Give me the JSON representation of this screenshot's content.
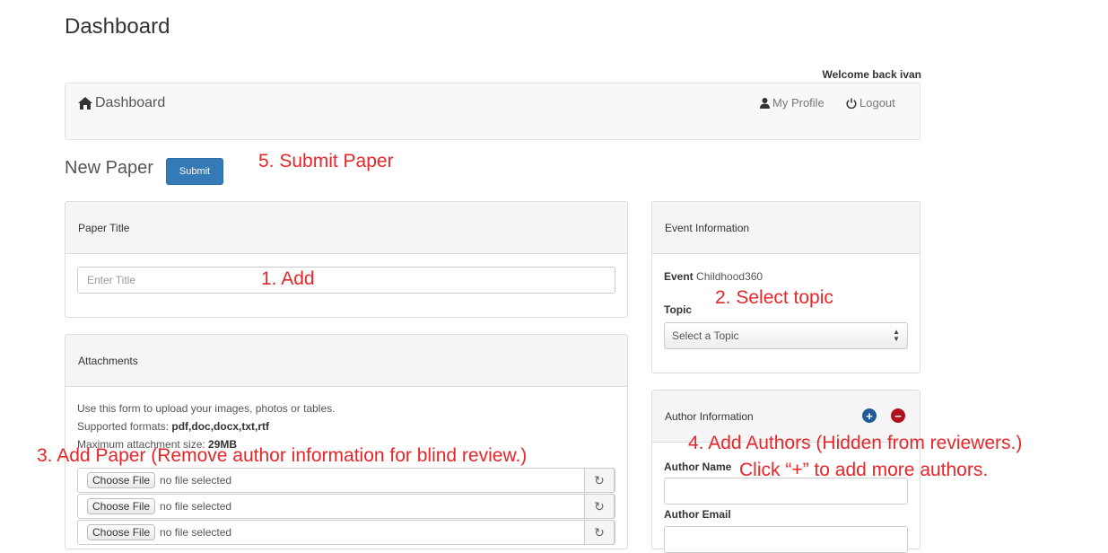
{
  "page": {
    "title": "Dashboard",
    "welcome": "Welcome back ivan"
  },
  "navbar": {
    "brand": "Dashboard",
    "profile": "My Profile",
    "logout": "Logout"
  },
  "new_paper": {
    "title": "New Paper",
    "submit_label": "Submit"
  },
  "paper_title_panel": {
    "heading": "Paper Title",
    "placeholder": "Enter Title"
  },
  "attachments": {
    "heading": "Attachments",
    "line1": "Use this form to upload your images, photos or tables.",
    "formats_label": "Supported formats: ",
    "formats_value": "pdf,doc,docx,txt,rtf",
    "max_label": "Maximum attachment size: ",
    "max_value": "29MB",
    "files": [
      {
        "button": "Choose File",
        "status": "no file selected"
      },
      {
        "button": "Choose File",
        "status": "no file selected"
      },
      {
        "button": "Choose File",
        "status": "no file selected"
      }
    ]
  },
  "event_panel": {
    "heading": "Event Information",
    "event_label": "Event",
    "event_value": "Childhood360",
    "topic_label": "Topic",
    "topic_selected": "Select a Topic"
  },
  "author_panel": {
    "heading": "Author Information",
    "add_symbol": "+",
    "remove_symbol": "−",
    "name_label": "Author Name",
    "email_label": "Author Email"
  },
  "annotations": {
    "a1": "1. Add",
    "a2": "2. Select topic",
    "a3": "3. Add Paper (Remove author information for blind review.)",
    "a4_line1": "4. Add Authors (Hidden from reviewers.)",
    "a4_line2": "Click “+” to add more authors.",
    "a5": "5. Submit Paper"
  },
  "colors": {
    "annotation": "#e8262a",
    "primary": "#337ab7",
    "add_button": "#1f5c99",
    "remove_button": "#b0121b"
  }
}
